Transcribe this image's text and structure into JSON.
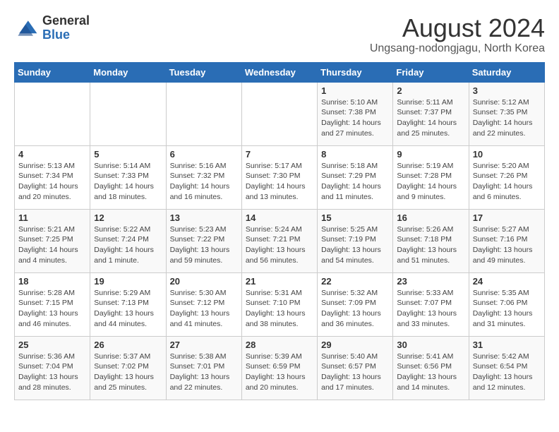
{
  "header": {
    "logo_general": "General",
    "logo_blue": "Blue",
    "month_title": "August 2024",
    "location": "Ungsang-nodongjagu, North Korea"
  },
  "days_of_week": [
    "Sunday",
    "Monday",
    "Tuesday",
    "Wednesday",
    "Thursday",
    "Friday",
    "Saturday"
  ],
  "weeks": [
    [
      {
        "day": "",
        "info": ""
      },
      {
        "day": "",
        "info": ""
      },
      {
        "day": "",
        "info": ""
      },
      {
        "day": "",
        "info": ""
      },
      {
        "day": "1",
        "info": "Sunrise: 5:10 AM\nSunset: 7:38 PM\nDaylight: 14 hours and 27 minutes."
      },
      {
        "day": "2",
        "info": "Sunrise: 5:11 AM\nSunset: 7:37 PM\nDaylight: 14 hours and 25 minutes."
      },
      {
        "day": "3",
        "info": "Sunrise: 5:12 AM\nSunset: 7:35 PM\nDaylight: 14 hours and 22 minutes."
      }
    ],
    [
      {
        "day": "4",
        "info": "Sunrise: 5:13 AM\nSunset: 7:34 PM\nDaylight: 14 hours and 20 minutes."
      },
      {
        "day": "5",
        "info": "Sunrise: 5:14 AM\nSunset: 7:33 PM\nDaylight: 14 hours and 18 minutes."
      },
      {
        "day": "6",
        "info": "Sunrise: 5:16 AM\nSunset: 7:32 PM\nDaylight: 14 hours and 16 minutes."
      },
      {
        "day": "7",
        "info": "Sunrise: 5:17 AM\nSunset: 7:30 PM\nDaylight: 14 hours and 13 minutes."
      },
      {
        "day": "8",
        "info": "Sunrise: 5:18 AM\nSunset: 7:29 PM\nDaylight: 14 hours and 11 minutes."
      },
      {
        "day": "9",
        "info": "Sunrise: 5:19 AM\nSunset: 7:28 PM\nDaylight: 14 hours and 9 minutes."
      },
      {
        "day": "10",
        "info": "Sunrise: 5:20 AM\nSunset: 7:26 PM\nDaylight: 14 hours and 6 minutes."
      }
    ],
    [
      {
        "day": "11",
        "info": "Sunrise: 5:21 AM\nSunset: 7:25 PM\nDaylight: 14 hours and 4 minutes."
      },
      {
        "day": "12",
        "info": "Sunrise: 5:22 AM\nSunset: 7:24 PM\nDaylight: 14 hours and 1 minute."
      },
      {
        "day": "13",
        "info": "Sunrise: 5:23 AM\nSunset: 7:22 PM\nDaylight: 13 hours and 59 minutes."
      },
      {
        "day": "14",
        "info": "Sunrise: 5:24 AM\nSunset: 7:21 PM\nDaylight: 13 hours and 56 minutes."
      },
      {
        "day": "15",
        "info": "Sunrise: 5:25 AM\nSunset: 7:19 PM\nDaylight: 13 hours and 54 minutes."
      },
      {
        "day": "16",
        "info": "Sunrise: 5:26 AM\nSunset: 7:18 PM\nDaylight: 13 hours and 51 minutes."
      },
      {
        "day": "17",
        "info": "Sunrise: 5:27 AM\nSunset: 7:16 PM\nDaylight: 13 hours and 49 minutes."
      }
    ],
    [
      {
        "day": "18",
        "info": "Sunrise: 5:28 AM\nSunset: 7:15 PM\nDaylight: 13 hours and 46 minutes."
      },
      {
        "day": "19",
        "info": "Sunrise: 5:29 AM\nSunset: 7:13 PM\nDaylight: 13 hours and 44 minutes."
      },
      {
        "day": "20",
        "info": "Sunrise: 5:30 AM\nSunset: 7:12 PM\nDaylight: 13 hours and 41 minutes."
      },
      {
        "day": "21",
        "info": "Sunrise: 5:31 AM\nSunset: 7:10 PM\nDaylight: 13 hours and 38 minutes."
      },
      {
        "day": "22",
        "info": "Sunrise: 5:32 AM\nSunset: 7:09 PM\nDaylight: 13 hours and 36 minutes."
      },
      {
        "day": "23",
        "info": "Sunrise: 5:33 AM\nSunset: 7:07 PM\nDaylight: 13 hours and 33 minutes."
      },
      {
        "day": "24",
        "info": "Sunrise: 5:35 AM\nSunset: 7:06 PM\nDaylight: 13 hours and 31 minutes."
      }
    ],
    [
      {
        "day": "25",
        "info": "Sunrise: 5:36 AM\nSunset: 7:04 PM\nDaylight: 13 hours and 28 minutes."
      },
      {
        "day": "26",
        "info": "Sunrise: 5:37 AM\nSunset: 7:02 PM\nDaylight: 13 hours and 25 minutes."
      },
      {
        "day": "27",
        "info": "Sunrise: 5:38 AM\nSunset: 7:01 PM\nDaylight: 13 hours and 22 minutes."
      },
      {
        "day": "28",
        "info": "Sunrise: 5:39 AM\nSunset: 6:59 PM\nDaylight: 13 hours and 20 minutes."
      },
      {
        "day": "29",
        "info": "Sunrise: 5:40 AM\nSunset: 6:57 PM\nDaylight: 13 hours and 17 minutes."
      },
      {
        "day": "30",
        "info": "Sunrise: 5:41 AM\nSunset: 6:56 PM\nDaylight: 13 hours and 14 minutes."
      },
      {
        "day": "31",
        "info": "Sunrise: 5:42 AM\nSunset: 6:54 PM\nDaylight: 13 hours and 12 minutes."
      }
    ]
  ]
}
